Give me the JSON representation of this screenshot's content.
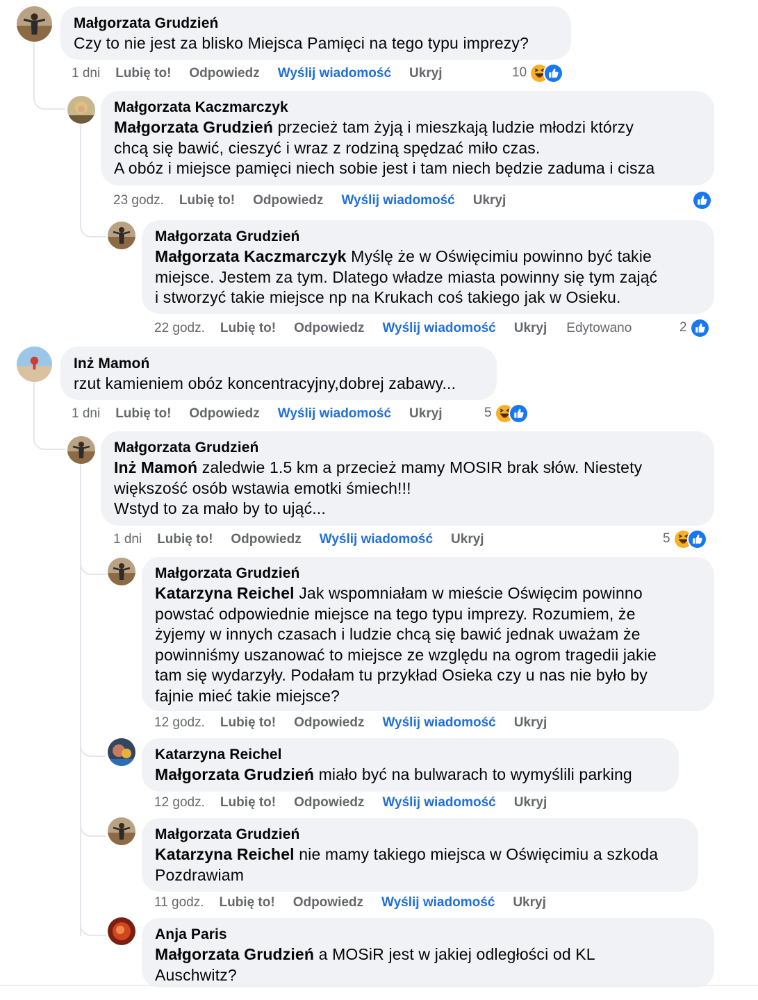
{
  "actions": {
    "like": "Lubię to!",
    "reply": "Odpowiedz",
    "send_message": "Wyślij wiadomość",
    "hide": "Ukryj",
    "edited": "Edytowano"
  },
  "colors": {
    "bubble_bg": "#f0f2f5",
    "link_blue": "#216fdb",
    "meta_gray": "#65676b",
    "like_blue": "#1877f2",
    "haha_yellow": "#f7b125"
  },
  "comments": [
    {
      "author": "Małgorzata Grudzień",
      "text": "Czy to nie jest za blisko Miejsca Pamięci na tego typu imprezy?",
      "time": "1 dni",
      "reactions": {
        "count": "10",
        "icons": [
          "haha-icon",
          "like-icon"
        ]
      }
    },
    {
      "author": "Małgorzata Kaczmarczyk",
      "mention": "Małgorzata Grudzień",
      "text": " przecież tam żyją i mieszkają ludzie młodzi którzy\nchcą się bawić, cieszyć i wraz z rodziną spędzać miło czas.\nA obóz i miejsce pamięci niech sobie jest i tam niech będzie zaduma i cisza",
      "time": "23 godz.",
      "reactions": {
        "count": "",
        "icons": [
          "like-icon"
        ]
      }
    },
    {
      "author": "Małgorzata Grudzień",
      "mention": "Małgorzata Kaczmarczyk",
      "text": " Myślę że w Oświęcimiu powinno być takie\nmiejsce. Jestem za tym. Dlatego władze miasta powinny się tym zająć\ni stworzyć takie miejsce np na Krukach coś takiego jak w Osieku.",
      "time": "22 godz.",
      "edited": true,
      "reactions": {
        "count": "2",
        "icons": [
          "like-icon"
        ]
      }
    },
    {
      "author": "Inż Mamoń",
      "text": "rzut kamieniem obóz koncentracyjny,dobrej zabawy...",
      "time": "1 dni",
      "reactions": {
        "count": "5",
        "icons": [
          "haha-icon",
          "like-icon"
        ]
      }
    },
    {
      "author": "Małgorzata Grudzień",
      "mention": "Inż Mamoń",
      "text": " zaledwie 1.5 km a przecież mamy MOSIR brak słów. Niestety\nwiększość osób wstawia emotki śmiech!!!\nWstyd to za mało by to ująć...",
      "time": "1 dni",
      "reactions": {
        "count": "5",
        "icons": [
          "haha-icon",
          "like-icon"
        ]
      }
    },
    {
      "author": "Małgorzata Grudzień",
      "mention": "Katarzyna Reichel",
      "text": " Jak wspomniałam w mieście Oświęcim powinno\npowstać odpowiednie miejsce na tego typu imprezy. Rozumiem, że\nżyjemy w innych czasach i ludzie chcą się bawić jednak uważam że\npowinniśmy uszanować to miejsce ze względu na ogrom tragedii jakie\ntam się wydarzyły. Podałam tu przykład Osieka czy u nas nie było by\nfajnie mieć takie miejsce?",
      "time": "12 godz."
    },
    {
      "author": "Katarzyna Reichel",
      "mention": "Małgorzata Grudzień",
      "text": " miało być na bulwarach to wymyślili parking",
      "time": "12 godz."
    },
    {
      "author": "Małgorzata Grudzień",
      "mention": "Katarzyna Reichel",
      "text": " nie mamy takiego miejsca w Oświęcimiu a szkoda\nPozdrawiam",
      "time": "11 godz."
    },
    {
      "author": "Anja Paris",
      "mention": "Małgorzata Grudzień",
      "text": " a MOSiR jest w jakiej odległości od KL\nAuschwitz?"
    }
  ]
}
